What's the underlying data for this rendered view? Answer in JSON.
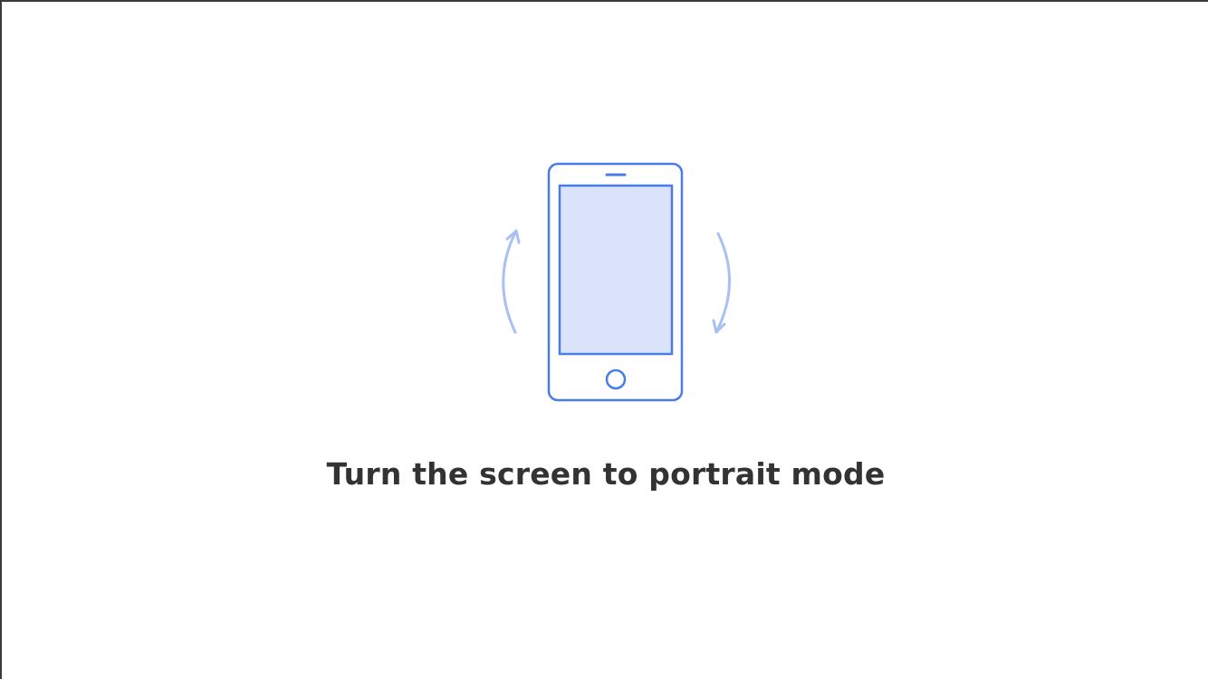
{
  "prompt": {
    "message": "Turn the screen to portrait mode"
  },
  "icons": {
    "phone": "phone-icon",
    "rotate_left": "rotate-arrow-up-icon",
    "rotate_right": "rotate-arrow-down-icon"
  },
  "colors": {
    "background": "#ffffff",
    "phone_outline": "#4a7ce8",
    "phone_screen_fill": "#dbe3fa",
    "arrow": "#a9c0f3",
    "text": "#333333"
  }
}
